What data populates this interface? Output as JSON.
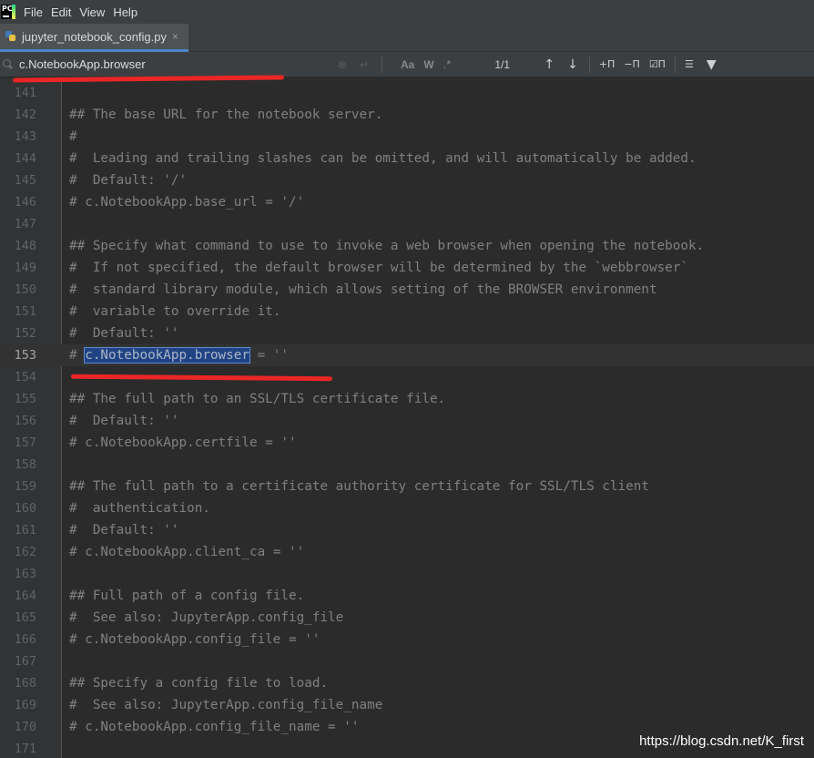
{
  "menu": {
    "logo_text": "PC",
    "items": [
      "File",
      "Edit",
      "View",
      "Help"
    ]
  },
  "tab": {
    "label": "jupyter_notebook_config.py",
    "close": "×"
  },
  "find": {
    "query": "c.NotebookApp.browser",
    "match_case": "Aa",
    "words": "W",
    "regex": ".*",
    "match_count": "1/1"
  },
  "editor": {
    "current_line": 153,
    "highlight_text": "c.NotebookApp.browser",
    "lines": [
      {
        "n": "141",
        "text": ""
      },
      {
        "n": "142",
        "text": "## The base URL for the notebook server."
      },
      {
        "n": "143",
        "text": "#"
      },
      {
        "n": "144",
        "text": "#  Leading and trailing slashes can be omitted, and will automatically be added."
      },
      {
        "n": "145",
        "text": "#  Default: '/'"
      },
      {
        "n": "146",
        "text": "# c.NotebookApp.base_url = '/'"
      },
      {
        "n": "147",
        "text": ""
      },
      {
        "n": "148",
        "text": "## Specify what command to use to invoke a web browser when opening the notebook."
      },
      {
        "n": "149",
        "text": "#  If not specified, the default browser will be determined by the `webbrowser`"
      },
      {
        "n": "150",
        "text": "#  standard library module, which allows setting of the BROWSER environment"
      },
      {
        "n": "151",
        "text": "#  variable to override it."
      },
      {
        "n": "152",
        "text": "#  Default: ''"
      },
      {
        "n": "153",
        "text": "# c.NotebookApp.browser = ''"
      },
      {
        "n": "154",
        "text": ""
      },
      {
        "n": "155",
        "text": "## The full path to an SSL/TLS certificate file."
      },
      {
        "n": "156",
        "text": "#  Default: ''"
      },
      {
        "n": "157",
        "text": "# c.NotebookApp.certfile = ''"
      },
      {
        "n": "158",
        "text": ""
      },
      {
        "n": "159",
        "text": "## The full path to a certificate authority certificate for SSL/TLS client"
      },
      {
        "n": "160",
        "text": "#  authentication."
      },
      {
        "n": "161",
        "text": "#  Default: ''"
      },
      {
        "n": "162",
        "text": "# c.NotebookApp.client_ca = ''"
      },
      {
        "n": "163",
        "text": ""
      },
      {
        "n": "164",
        "text": "## Full path of a config file."
      },
      {
        "n": "165",
        "text": "#  See also: JupyterApp.config_file"
      },
      {
        "n": "166",
        "text": "# c.NotebookApp.config_file = ''"
      },
      {
        "n": "167",
        "text": ""
      },
      {
        "n": "168",
        "text": "## Specify a config file to load."
      },
      {
        "n": "169",
        "text": "#  See also: JupyterApp.config_file_name"
      },
      {
        "n": "170",
        "text": "# c.NotebookApp.config_file_name = ''"
      },
      {
        "n": "171",
        "text": ""
      }
    ]
  },
  "watermark": "https://blog.csdn.net/K_first",
  "colors": {
    "background": "#2b2b2b",
    "gutter": "#313335",
    "comment": "#808080",
    "selection": "#214283",
    "annotation_red": "#ea2626"
  }
}
